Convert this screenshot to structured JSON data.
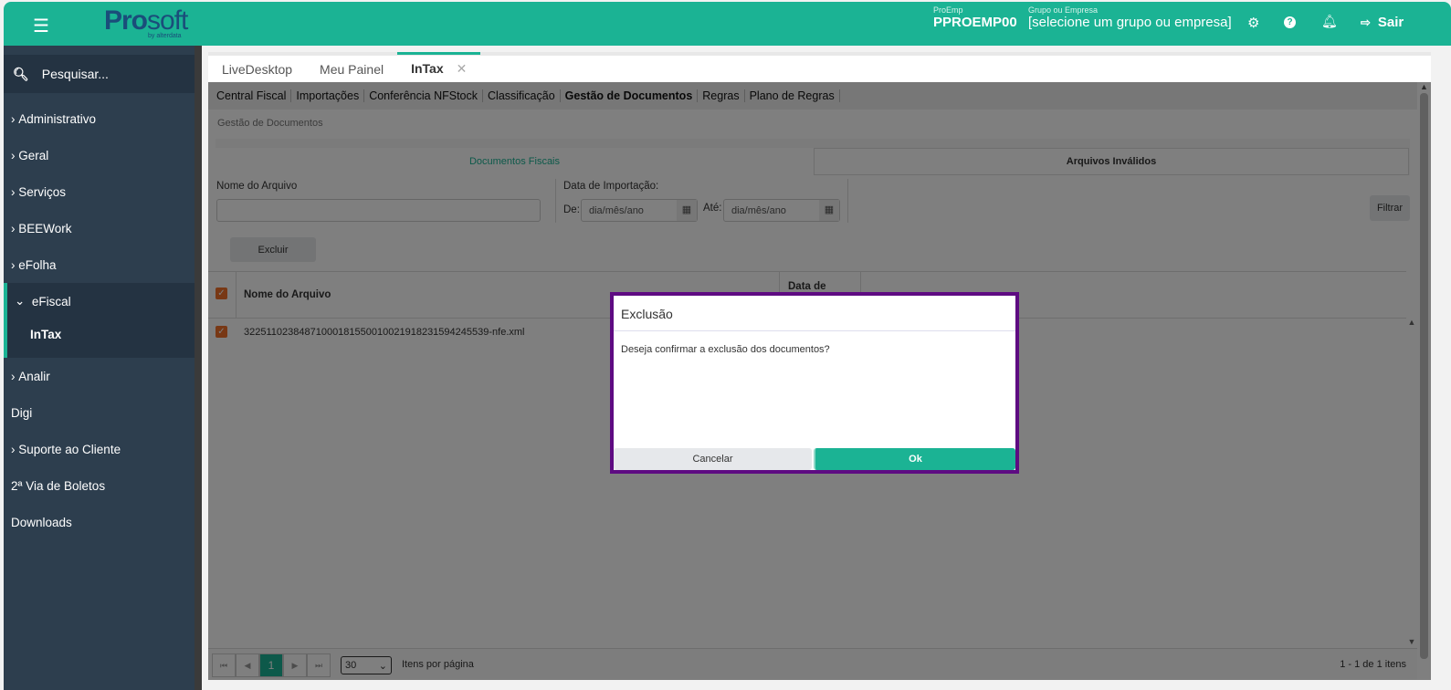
{
  "header": {
    "brand_pro": "Pro",
    "brand_soft": "soft",
    "brand_sub": "by alterdata",
    "proemp_label": "ProEmp",
    "proemp_value": "PPROEMP00",
    "group_label": "Grupo ou Empresa",
    "group_value": "[selecione um grupo ou empresa]",
    "logout": "Sair"
  },
  "sidebar": {
    "search": "Pesquisar...",
    "items": [
      {
        "label": "Administrativo"
      },
      {
        "label": "Geral"
      },
      {
        "label": "Serviços"
      },
      {
        "label": "BEEWork"
      },
      {
        "label": "eFolha"
      },
      {
        "label": "eFiscal"
      },
      {
        "label": "InTax"
      },
      {
        "label": "Analir"
      },
      {
        "label": "Digi"
      },
      {
        "label": "Suporte ao Cliente"
      },
      {
        "label": "2ª Via de Boletos"
      },
      {
        "label": "Downloads"
      }
    ]
  },
  "tabs": [
    {
      "label": "LiveDesktop"
    },
    {
      "label": "Meu Painel"
    },
    {
      "label": "InTax"
    }
  ],
  "subnav": [
    "Central Fiscal",
    "Importações",
    "Conferência NFStock",
    "Classificação",
    "Gestão de Documentos",
    "Regras",
    "Plano de Regras"
  ],
  "breadcrumb": "Gestão de Documentos",
  "doc_tabs": [
    "Documentos Fiscais",
    "Arquivos Inválidos"
  ],
  "filters": {
    "file_label": "Nome do Arquivo",
    "file_value": "",
    "date_label": "Data de Importação:",
    "from_label": "De:",
    "to_label": "Até:",
    "date_placeholder": "dia/mês/ano",
    "filter_btn": "Filtrar",
    "delete_btn": "Excluir"
  },
  "table": {
    "columns": [
      "Nome do Arquivo",
      "Data de"
    ],
    "rows": [
      {
        "name": "32251102384871000181550010021918231594245539-nfe.xml"
      }
    ]
  },
  "pager": {
    "page": "1",
    "page_size": "30",
    "per_page_label": "Itens por página",
    "summary": "1 - 1 de 1 itens"
  },
  "dialog": {
    "title": "Exclusão",
    "message": "Deseja confirmar a exclusão dos documentos?",
    "cancel": "Cancelar",
    "ok": "Ok"
  },
  "colors": {
    "accent": "#1bb394",
    "dialog_border": "#5e0b82"
  }
}
